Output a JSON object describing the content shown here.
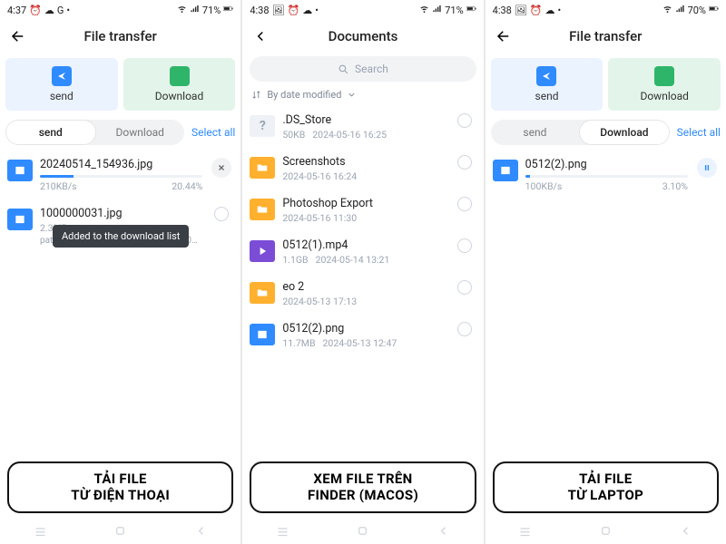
{
  "phones": [
    {
      "status": {
        "time": "4:37",
        "battery": "71%"
      },
      "title": "File transfer",
      "big": {
        "send": "send",
        "download": "Download"
      },
      "tabs": {
        "a": "send",
        "b": "Download",
        "active": "a",
        "select_all": "Select all"
      },
      "files": [
        {
          "kind": "image",
          "name": "20240514_154936.jpg",
          "progress_pct": 20.44,
          "speed": "210KB/s",
          "pct_label": "20.44%",
          "trail": "x"
        },
        {
          "kind": "image",
          "name": "1000000031.jpg",
          "size": "2.3MB",
          "path": "path: /Users/deminegirl1/Desktop/1000000..",
          "toast": "Added to the download list",
          "trail": "circle"
        }
      ],
      "caption_l1": "TẢI FILE",
      "caption_l2": "TỪ ĐIỆN THOẠI"
    },
    {
      "status": {
        "time": "4:38",
        "battery": "71%"
      },
      "title": "Documents",
      "search_placeholder": "Search",
      "sort_label": "By date modified",
      "list": [
        {
          "kind": "unknown",
          "name": ".DS_Store",
          "size": "50KB",
          "date": "2024-05-16 16:25"
        },
        {
          "kind": "folder",
          "name": "Screenshots",
          "date": "2024-05-16 16:24"
        },
        {
          "kind": "folder",
          "name": "Photoshop Export",
          "date": "2024-05-16 11:30"
        },
        {
          "kind": "video",
          "name": "0512(1).mp4",
          "size": "1.1GB",
          "date": "2024-05-14 13:21"
        },
        {
          "kind": "folder",
          "name": "eo 2",
          "date": "2024-05-13 17:13"
        },
        {
          "kind": "image",
          "name": "0512(2).png",
          "size": "11.7MB",
          "date": "2024-05-13 12:47"
        }
      ],
      "caption_l1": "XEM FILE TRÊN",
      "caption_l2": "FINDER (MACOS)"
    },
    {
      "status": {
        "time": "4:38",
        "battery": "70%"
      },
      "title": "File transfer",
      "big": {
        "send": "send",
        "download": "Download"
      },
      "tabs": {
        "a": "send",
        "b": "Download",
        "active": "b",
        "select_all": "Select all"
      },
      "files": [
        {
          "kind": "image",
          "name": "0512(2).png",
          "progress_pct": 3.1,
          "speed": "100KB/s",
          "pct_label": "3.10%",
          "trail": "pause"
        }
      ],
      "caption_l1": "TẢI FILE",
      "caption_l2": "TỪ LAPTOP"
    }
  ]
}
